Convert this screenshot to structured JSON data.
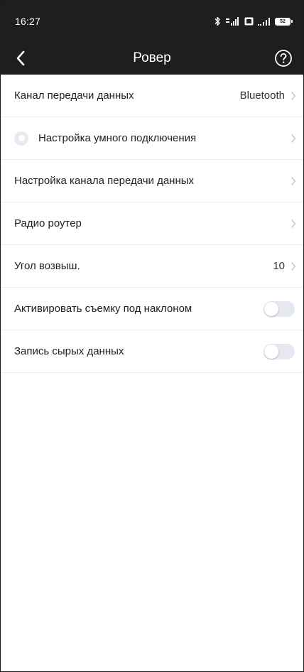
{
  "status_bar": {
    "time": "16:27",
    "battery": "52"
  },
  "nav": {
    "title": "Ровер"
  },
  "settings": {
    "data_channel": {
      "label": "Канал передачи данных",
      "value": "Bluetooth"
    },
    "smart_connect": {
      "label": "Настройка умного подключения"
    },
    "channel_setup": {
      "label": "Настройка канала передачи данных"
    },
    "radio_router": {
      "label": "Радио роутер"
    },
    "elevation_angle": {
      "label": "Угол возвыш.",
      "value": "10"
    },
    "tilt_survey": {
      "label": "Активировать съемку под наклоном",
      "enabled": false
    },
    "raw_data": {
      "label": "Запись сырых данных",
      "enabled": false
    }
  },
  "colors": {
    "header_bg": "#1e1e1e",
    "divider": "#ececec",
    "chevron": "#c4c4c4",
    "toggle_off": "#e6e8f0"
  }
}
